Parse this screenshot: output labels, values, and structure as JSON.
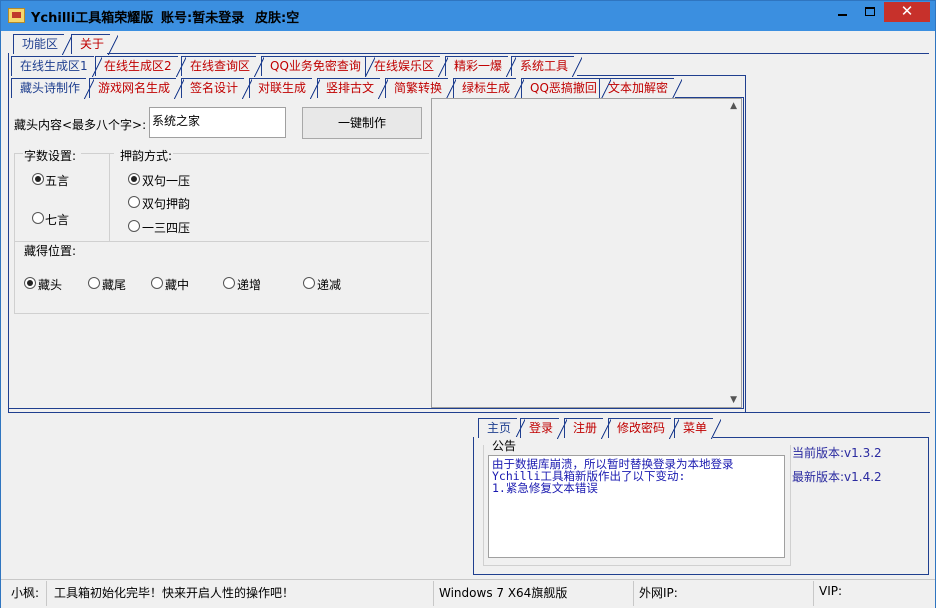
{
  "titlebar": {
    "app_name": "Ychilli工具箱荣耀版",
    "account": "账号:暂未登录",
    "skin": "皮肤:空"
  },
  "main_tabs": [
    {
      "label": "功能区",
      "active": true
    },
    {
      "label": "关于",
      "active": false
    }
  ],
  "category_tabs": [
    {
      "label": "在线生成区1",
      "active": true
    },
    {
      "label": "在线生成区2",
      "active": false
    },
    {
      "label": "在线查询区",
      "active": false
    },
    {
      "label": "QQ业务免密查询",
      "active": false
    },
    {
      "label": "在线娱乐区",
      "active": false
    },
    {
      "label": "精彩一爆",
      "active": false
    },
    {
      "label": "系统工具",
      "active": false
    }
  ],
  "tool_tabs": [
    {
      "label": "藏头诗制作",
      "active": true
    },
    {
      "label": "游戏网名生成",
      "active": false
    },
    {
      "label": "签名设计",
      "active": false
    },
    {
      "label": "对联生成",
      "active": false
    },
    {
      "label": "竖排古文",
      "active": false
    },
    {
      "label": "简繁转换",
      "active": false
    },
    {
      "label": "绿标生成",
      "active": false
    },
    {
      "label": "QQ恶搞撤回",
      "active": false
    },
    {
      "label": "文本加解密",
      "active": false
    }
  ],
  "poem_form": {
    "content_label": "藏头内容<最多八个字>:",
    "content_value": "系统之家",
    "make_button": "一键制作",
    "word_count_label": "字数设置:",
    "word_count_options": [
      {
        "label": "五言",
        "checked": true
      },
      {
        "label": "七言",
        "checked": false
      }
    ],
    "rhyme_label": "押韵方式:",
    "rhyme_options": [
      {
        "label": "双句一压",
        "checked": true
      },
      {
        "label": "双句押韵",
        "checked": false
      },
      {
        "label": "一三四压",
        "checked": false
      }
    ],
    "position_label": "藏得位置:",
    "position_options": [
      {
        "label": "藏头",
        "checked": true
      },
      {
        "label": "藏尾",
        "checked": false
      },
      {
        "label": "藏中",
        "checked": false
      },
      {
        "label": "递增",
        "checked": false
      },
      {
        "label": "递减",
        "checked": false
      }
    ]
  },
  "bottom_tabs": [
    {
      "label": "主页",
      "active": true
    },
    {
      "label": "登录",
      "active": false
    },
    {
      "label": "注册",
      "active": false
    },
    {
      "label": "修改密码",
      "active": false
    },
    {
      "label": "菜单",
      "active": false
    }
  ],
  "notice": {
    "title": "公告",
    "lines": [
      "由于数据库崩溃，所以暂时替换登录为本地登录",
      "Ychilli工具箱新版作出了以下变动:",
      "1.紧急修复文本错误"
    ],
    "current_version": "当前版本:v1.3.2",
    "latest_version": "最新版本:v1.4.2"
  },
  "status": {
    "user_label": "小枫:",
    "message": "工具箱初始化完毕！快来开启人性的操作吧！",
    "os": "Windows 7  X64旗舰版",
    "ip_label": "外网IP:",
    "vip_label": "VIP:"
  },
  "colors": {
    "titlebar": "#3b8fe0",
    "tab_inactive_text": "#c00000",
    "tab_active_text": "#1f3f8f",
    "notice_text": "#1a1ab0",
    "close_button": "#c7312b"
  }
}
